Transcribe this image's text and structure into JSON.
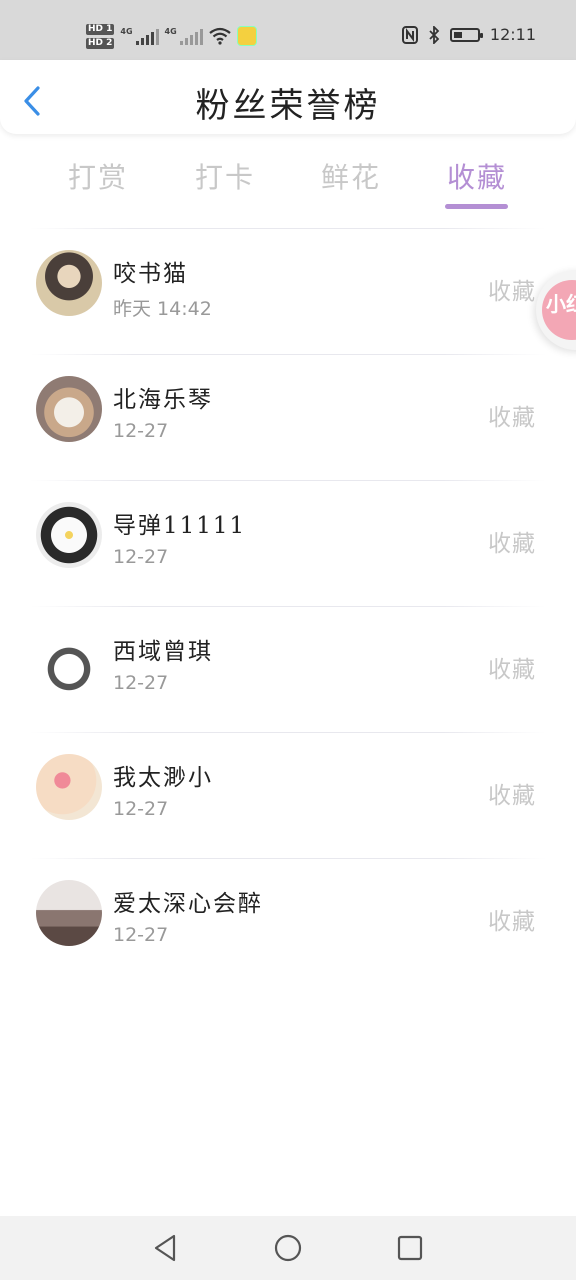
{
  "status_bar": {
    "time": "12:11",
    "sim_labels": [
      "HD 1",
      "HD 2"
    ],
    "network_labels": [
      "4G",
      "4G"
    ],
    "battery_level": 0.35
  },
  "header": {
    "title": "粉丝荣誉榜",
    "back_icon": "chevron-left-icon"
  },
  "tabs": [
    {
      "label": "打赏",
      "active": false
    },
    {
      "label": "打卡",
      "active": false
    },
    {
      "label": "鲜花",
      "active": false
    },
    {
      "label": "收藏",
      "active": true
    }
  ],
  "fans": [
    {
      "name": "咬书猫",
      "time": "昨天  14:42",
      "action": "收藏"
    },
    {
      "name": "北海乐琴",
      "time": "12-27",
      "action": "收藏"
    },
    {
      "name": "导弹11111",
      "time": "12-27",
      "action": "收藏"
    },
    {
      "name": "西域曾琪",
      "time": "12-27",
      "action": "收藏"
    },
    {
      "name": "我太渺小",
      "time": "12-27",
      "action": "收藏"
    },
    {
      "name": "爱太深心会醉",
      "time": "12-27",
      "action": "收藏"
    }
  ],
  "float_badge": {
    "text": "小红"
  },
  "colors": {
    "accent": "#b48fd4",
    "back_icon": "#3a8ee6",
    "inactive_text": "#c8c8c8",
    "status_bar_bg": "#d9d9d9"
  },
  "nav_icons": [
    "back-triangle-icon",
    "home-circle-icon",
    "recents-square-icon"
  ]
}
